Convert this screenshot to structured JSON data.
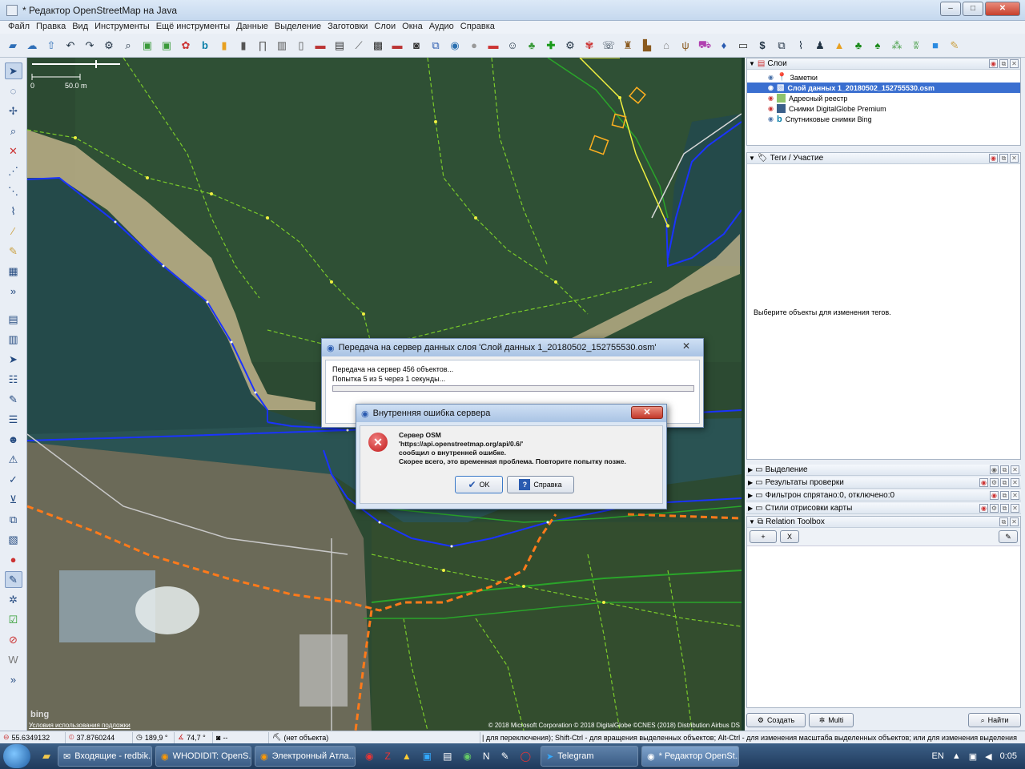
{
  "window": {
    "title": "* Редактор OpenStreetMap на Java"
  },
  "menu": [
    "Файл",
    "Правка",
    "Вид",
    "Инструменты",
    "Ещё инструменты",
    "Данные",
    "Выделение",
    "Заготовки",
    "Слои",
    "Окна",
    "Аудио",
    "Справка"
  ],
  "map": {
    "scale_label": "50.0 m",
    "scale_zero": "0",
    "copyright": "© 2018 Microsoft Corporation © 2018 DigitalGlobe ©CNES (2018) Distribution Airbus DS",
    "terms": "Условия использования подложки",
    "bing_logo": "bing"
  },
  "layers_panel": {
    "title": "Слои",
    "items": [
      {
        "label": "Заметки",
        "icon": "note-pin-icon",
        "selected": false
      },
      {
        "label": "Слой данных 1_20180502_152755530.osm",
        "icon": "data-layer-icon",
        "selected": true
      },
      {
        "label": "Адресный реестр",
        "icon": "address-layer-icon",
        "selected": false
      },
      {
        "label": "Снимки DigitalGlobe Premium",
        "icon": "imagery-icon",
        "selected": false
      },
      {
        "label": "Спутниковые снимки Bing",
        "icon": "bing-icon",
        "selected": false
      }
    ]
  },
  "tags_panel": {
    "title": "Теги / Участие",
    "empty_text": "Выберите объекты для изменения тегов."
  },
  "side_panels": [
    {
      "label": "Выделение",
      "icon": "selection-icon"
    },
    {
      "label": "Результаты проверки",
      "icon": "validation-icon"
    },
    {
      "label": "Фильтрон спрятано:0, отключено:0",
      "icon": "filter-icon"
    },
    {
      "label": "Стили отрисовки карты",
      "icon": "style-icon"
    },
    {
      "label": "Relation Toolbox",
      "icon": "relation-icon"
    }
  ],
  "relation_toolbox": {
    "add_btn": "+",
    "clear_btn": "X"
  },
  "bottom_buttons": {
    "create": "Создать",
    "multi": "Multi",
    "find": "Найти"
  },
  "upload_dialog": {
    "title": "Передача на сервер данных слоя 'Слой данных 1_20180502_152755530.osm'",
    "line1": "Передача на сервер 456 объектов...",
    "line2": "Попытка 5 из 5 через 1 секунды...",
    "progress": 0
  },
  "error_dialog": {
    "title": "Внутренняя ошибка сервера",
    "line1": "Сервер OSM",
    "line2": "'https://api.openstreetmap.org/api/0.6/'",
    "line3": "сообщил о внутренней ошибке.",
    "line4": "Скорее всего, это временная проблема. Повторите попытку позже.",
    "ok_label": "OK",
    "help_label": "Справка"
  },
  "status": {
    "lat": "55.6349132",
    "lon": "37.8760244",
    "heading": "189,9 °",
    "angle": "74,7 °",
    "distance": "--",
    "object": "(нет объекта)",
    "hint": "| для переключения); Shift-Ctrl - для вращения выделенных объектов; Alt-Ctrl - для изменения масштаба выделенных объектов; или для изменения выделения"
  },
  "taskbar": {
    "tasks": [
      {
        "label": "Входящие - redbik...",
        "icon": "mail-icon"
      },
      {
        "label": "WHODIDIT: OpenS...",
        "icon": "firefox-icon"
      },
      {
        "label": "Электронный Атла...",
        "icon": "firefox-icon"
      },
      {
        "label": "Telegram",
        "icon": "telegram-icon"
      },
      {
        "label": "* Редактор OpenSt...",
        "icon": "josm-icon"
      }
    ],
    "lang": "EN",
    "time": "0:05"
  },
  "colors": {
    "water_line": "#1a33ff",
    "highway_green": "#2aa52a",
    "orange_dash": "#ff7a1a",
    "selection_blue": "#3a6fd0",
    "error_red": "#d32020"
  }
}
